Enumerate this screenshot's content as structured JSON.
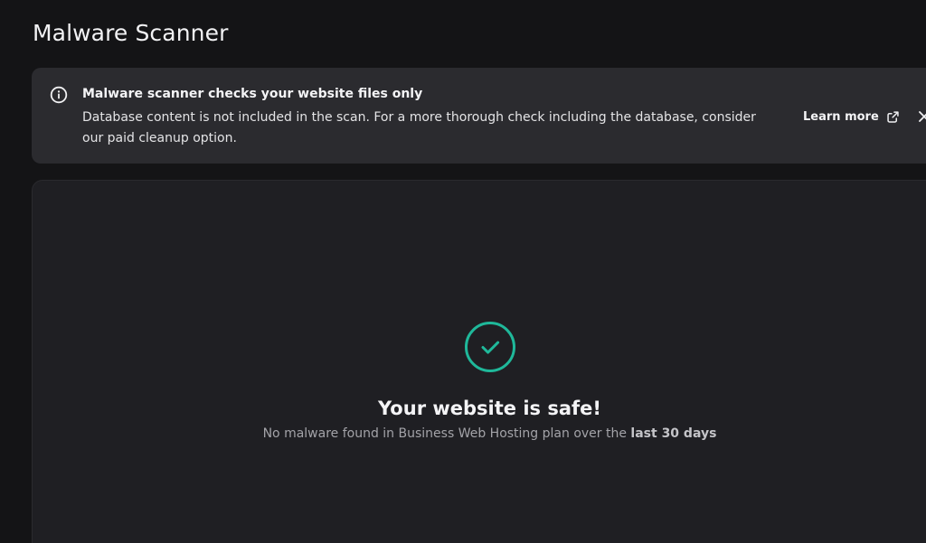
{
  "page": {
    "title": "Malware Scanner"
  },
  "alert": {
    "icon": "info-icon",
    "title": "Malware scanner checks your website files only",
    "text": "Database content is not included in the scan. For a more thorough check including the database, consider our paid cleanup option.",
    "learn_more_label": "Learn more",
    "learn_more_icon": "external-link-icon",
    "close_icon": "close-icon"
  },
  "status": {
    "icon": "check-circle-icon",
    "accent_color": "#1fb89a",
    "title": "Your website is safe!",
    "subtitle_prefix": "No malware found in Business Web Hosting plan over the ",
    "subtitle_emphasis": "last 30 days"
  }
}
